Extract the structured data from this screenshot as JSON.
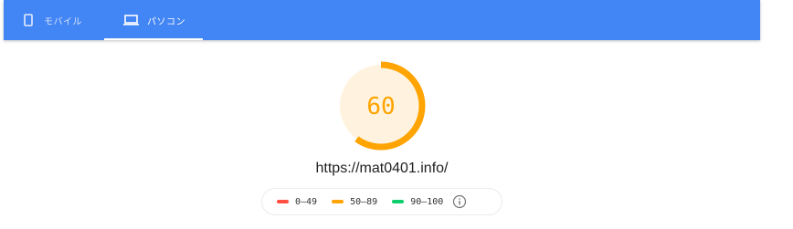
{
  "tabs": [
    {
      "label": "モバイル",
      "icon": "smartphone-icon",
      "selected": false
    },
    {
      "label": "パソコン",
      "icon": "laptop-icon",
      "selected": true
    }
  ],
  "colors": {
    "tabbar": "#4285f4",
    "fail": "#ff4e42",
    "average": "#ffa400",
    "pass": "#0cce6b",
    "gauge_bg": "#fff3e0"
  },
  "score": {
    "value": "60",
    "fraction": 0.6
  },
  "url": "https://mat0401.info/",
  "legend": [
    {
      "range": "0–49",
      "color": "#ff4e42"
    },
    {
      "range": "50–89",
      "color": "#ffa400"
    },
    {
      "range": "90–100",
      "color": "#0cce6b"
    }
  ],
  "legend_info_icon": "info-icon"
}
